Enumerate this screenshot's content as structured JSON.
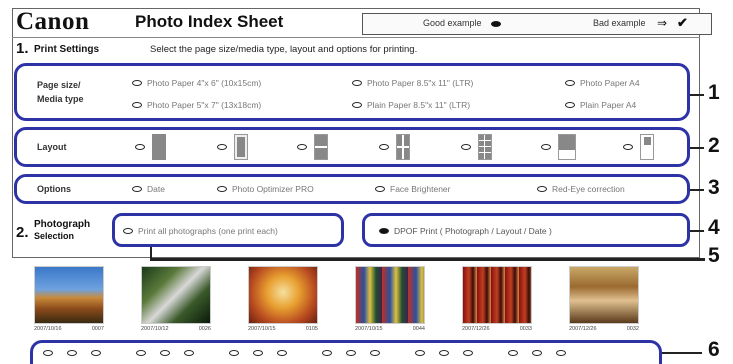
{
  "header": {
    "logo": "Canon",
    "title": "Photo Index Sheet",
    "good_example": "Good example",
    "bad_example": "Bad example"
  },
  "section1": {
    "number": "1.",
    "title": "Print Settings",
    "instruction": "Select the page size/media type, layout and options for printing."
  },
  "section2": {
    "number": "2.",
    "title_line1": "Photograph",
    "title_line2": "Selection"
  },
  "rows": {
    "media": {
      "label_line1": "Page size/",
      "label_line2": "Media type",
      "options": [
        "Photo Paper  4\"x 6\" (10x15cm)",
        "Photo Paper  8.5\"x 11\" (LTR)",
        "Photo Paper  A4",
        "Photo Paper  5\"x 7\" (13x18cm)",
        "Plain Paper  8.5\"x 11\" (LTR)",
        "Plain Paper  A4"
      ]
    },
    "layout": {
      "label": "Layout"
    },
    "options": {
      "label": "Options",
      "items": [
        "Date",
        "Photo Optimizer PRO",
        "Face Brightener",
        "Red-Eye correction"
      ]
    },
    "print_all": {
      "label": "Print all photographs  (one print each)"
    },
    "dpof": {
      "label": "DPOF Print  ( Photograph / Layout / Date )"
    }
  },
  "callouts": [
    "1",
    "2",
    "3",
    "4",
    "5",
    "6"
  ],
  "thumbs": [
    {
      "date": "2007/10/16",
      "id": "0007"
    },
    {
      "date": "2007/10/12",
      "id": "0026"
    },
    {
      "date": "2007/10/15",
      "id": "0105"
    },
    {
      "date": "2007/10/15",
      "id": "0044"
    },
    {
      "date": "2007/12/26",
      "id": "0033"
    },
    {
      "date": "2007/12/26",
      "id": "0032"
    }
  ],
  "colors": {
    "accent": "#2d33a5"
  }
}
